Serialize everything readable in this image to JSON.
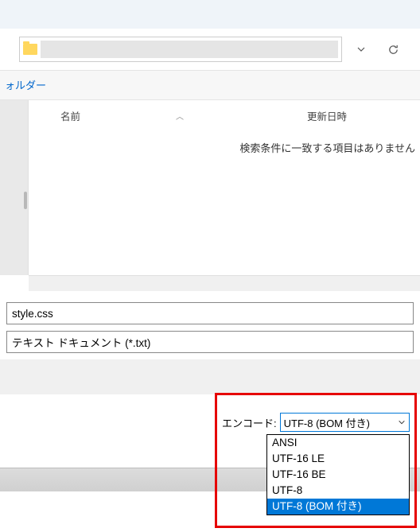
{
  "toolbar": {
    "folder_link": "ォルダー"
  },
  "columns": {
    "name": "名前",
    "date": "更新日時"
  },
  "empty_message": "検索条件に一致する項目はありません",
  "filename": {
    "value": "style.css"
  },
  "filetype": {
    "value": "テキスト ドキュメント (*.txt)"
  },
  "encoding": {
    "label": "エンコード:",
    "selected": "UTF-8 (BOM 付き)",
    "options": [
      "ANSI",
      "UTF-16 LE",
      "UTF-16 BE",
      "UTF-8",
      "UTF-8 (BOM 付き)"
    ],
    "highlighted_index": 4
  }
}
